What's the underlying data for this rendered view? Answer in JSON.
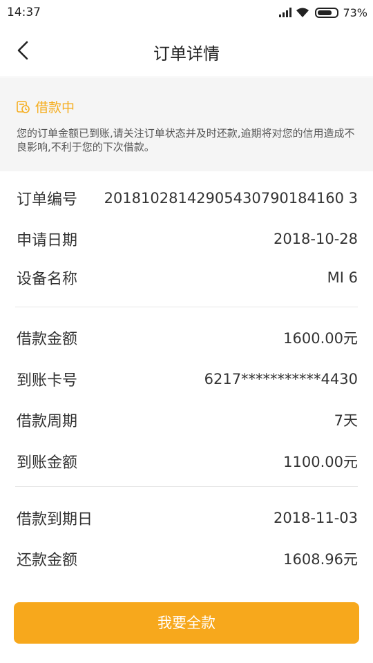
{
  "status_bar": {
    "time": "14:37",
    "battery": "73%"
  },
  "header": {
    "title": "订单详情"
  },
  "notice": {
    "status_label": "借款中",
    "message": "您的订单金额已到账,请关注订单状态并及时还款,逾期将对您的信用造成不良影响,不利于您的下次借款。"
  },
  "order_info": [
    {
      "label": "订单编号",
      "value": "20181028142905430790184160 3"
    },
    {
      "label": "申请日期",
      "value": "2018-10-28"
    },
    {
      "label": "设备名称",
      "value": "MI 6"
    }
  ],
  "loan_info": [
    {
      "label": "借款金额",
      "value": "1600.00元"
    },
    {
      "label": "到账卡号",
      "value": "6217***********4430"
    },
    {
      "label": "借款周期",
      "value": "7天"
    },
    {
      "label": "到账金额",
      "value": "1100.00元"
    }
  ],
  "repay_info": [
    {
      "label": "借款到期日",
      "value": "2018-11-03"
    },
    {
      "label": "还款金额",
      "value": "1608.96元"
    }
  ],
  "actions": {
    "repay_all_label": "我要全款"
  },
  "colors": {
    "accent": "#f7a81c",
    "status": "#f5ae21",
    "notice_bg": "#f5f5f5"
  }
}
